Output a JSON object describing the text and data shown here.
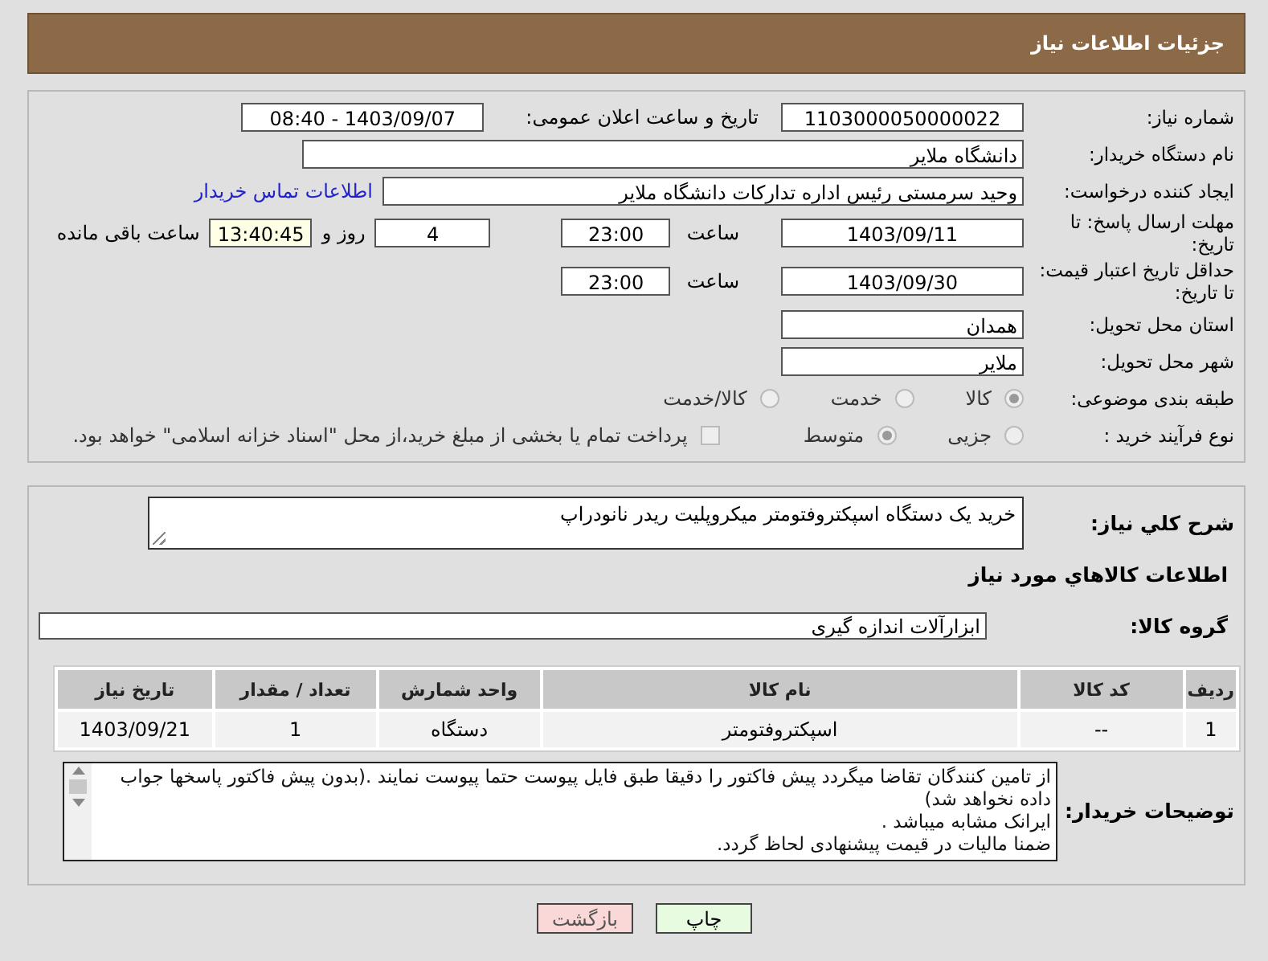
{
  "header": {
    "title": "جزئیات اطلاعات نیاز"
  },
  "need_number": {
    "label": "شماره نیاز:",
    "value": "1103000050000022"
  },
  "announce": {
    "label": "تاریخ و ساعت اعلان عمومی:",
    "value": "1403/09/07 - 08:40"
  },
  "buyer_org": {
    "label": "نام دستگاه خریدار:",
    "value": "دانشگاه ملایر"
  },
  "creator": {
    "label": "ایجاد کننده درخواست:",
    "value": "وحید سرمستی رئیس اداره تدارکات دانشگاه ملایر",
    "link": "اطلاعات تماس خریدار"
  },
  "deadline": {
    "label": "مهلت ارسال پاسخ: تا تاریخ:",
    "date": "1403/09/11",
    "time_label": "ساعت",
    "time": "23:00",
    "days": "4",
    "days_label": "روز و",
    "remaining": "13:40:45",
    "remaining_label": "ساعت باقی مانده"
  },
  "validity": {
    "label": "حداقل تاریخ اعتبار قیمت: تا تاریخ:",
    "date": "1403/09/30",
    "time_label": "ساعت",
    "time": "23:00"
  },
  "province": {
    "label": "استان محل تحویل:",
    "value": "همدان"
  },
  "city": {
    "label": "شهر محل تحویل:",
    "value": "ملایر"
  },
  "category": {
    "label": "طبقه بندی موضوعی:",
    "options": [
      {
        "label": "كالا",
        "selected": true
      },
      {
        "label": "خدمت",
        "selected": false
      },
      {
        "label": "كالا/خدمت",
        "selected": false
      }
    ]
  },
  "process": {
    "label": "نوع فرآیند خرید :",
    "options": [
      {
        "label": "جزیی",
        "selected": false
      },
      {
        "label": "متوسط",
        "selected": true
      }
    ],
    "treasury": {
      "label": "پرداخت تمام یا بخشی از مبلغ خرید،از محل \"اسناد خزانه اسلامی\" خواهد بود.",
      "checked": false
    }
  },
  "description": {
    "label": "شرح کلي نياز:",
    "value": "خرید یک دستگاه اسپکتروفتومتر میکروپلیت ریدر نانودراپ"
  },
  "goods_title": "اطلاعات كالاهاي مورد نياز",
  "goods_group": {
    "label": "گروه کالا:",
    "value": "ابزارآلات اندازه گیری"
  },
  "table": {
    "columns": [
      "ردیف",
      "کد کالا",
      "نام کالا",
      "واحد شمارش",
      "تعداد / مقدار",
      "تاریخ نیاز"
    ],
    "rows": [
      [
        "1",
        "--",
        "اسپکتروفتومتر",
        "دستگاه",
        "1",
        "1403/09/21"
      ]
    ]
  },
  "buyer_notes": {
    "label": "توضیحات خریدار:",
    "lines": [
      "از تامین کنندگان تقاضا میگردد پیش فاکتور را دقیقا طبق فایل پیوست حتما پیوست نمایند .(بدون پیش فاکتور پاسخها جواب داده نخواهد شد)",
      "ایرانک مشابه میباشد .",
      "ضمنا مالیات در قیمت پیشنهادی لحاظ گردد."
    ]
  },
  "buttons": [
    {
      "label": "چاپ",
      "kind": "print"
    },
    {
      "label": "بازگشت",
      "kind": "back"
    }
  ]
}
